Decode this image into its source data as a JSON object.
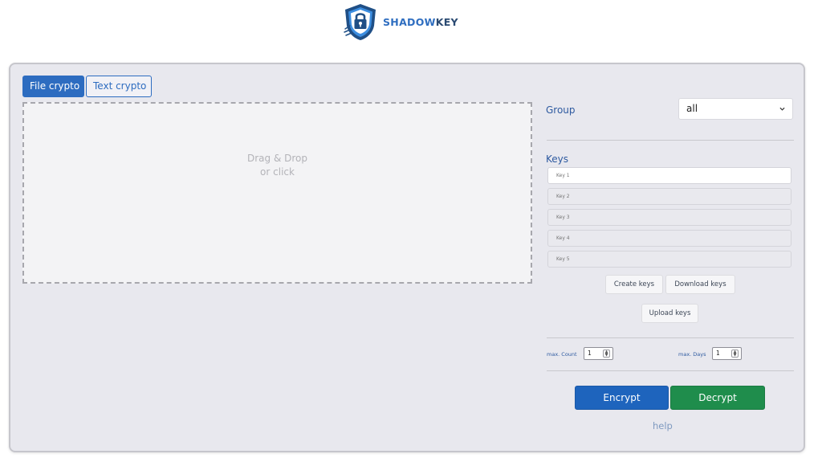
{
  "brand": {
    "name_part1": "SHADOW",
    "name_part2": "KEY",
    "colors": {
      "shield": "#1f4f86",
      "accent": "#2f6ec0"
    }
  },
  "tabs": [
    {
      "label": "File crypto",
      "active": true
    },
    {
      "label": "Text crypto",
      "active": false
    }
  ],
  "dropzone": {
    "line1": "Drag & Drop",
    "line2": "or click"
  },
  "group": {
    "label": "Group",
    "selected": "all"
  },
  "keys": {
    "label": "Keys",
    "placeholders": [
      "Key 1",
      "Key 2",
      "Key 3",
      "Key 4",
      "Key 5"
    ]
  },
  "actions": {
    "create_keys": "Create keys",
    "download_keys": "Download keys",
    "upload_keys": "Upload keys"
  },
  "limits": {
    "max_count_label": "max. Count",
    "max_count_value": "1",
    "max_days_label": "max. Days",
    "max_days_value": "1"
  },
  "buttons": {
    "encrypt": "Encrypt",
    "decrypt": "Decrypt",
    "help": "help"
  },
  "colors": {
    "primary_blue": "#1e64bd",
    "success_green": "#1f8d4c",
    "panel_bg": "#e8e8ee"
  }
}
